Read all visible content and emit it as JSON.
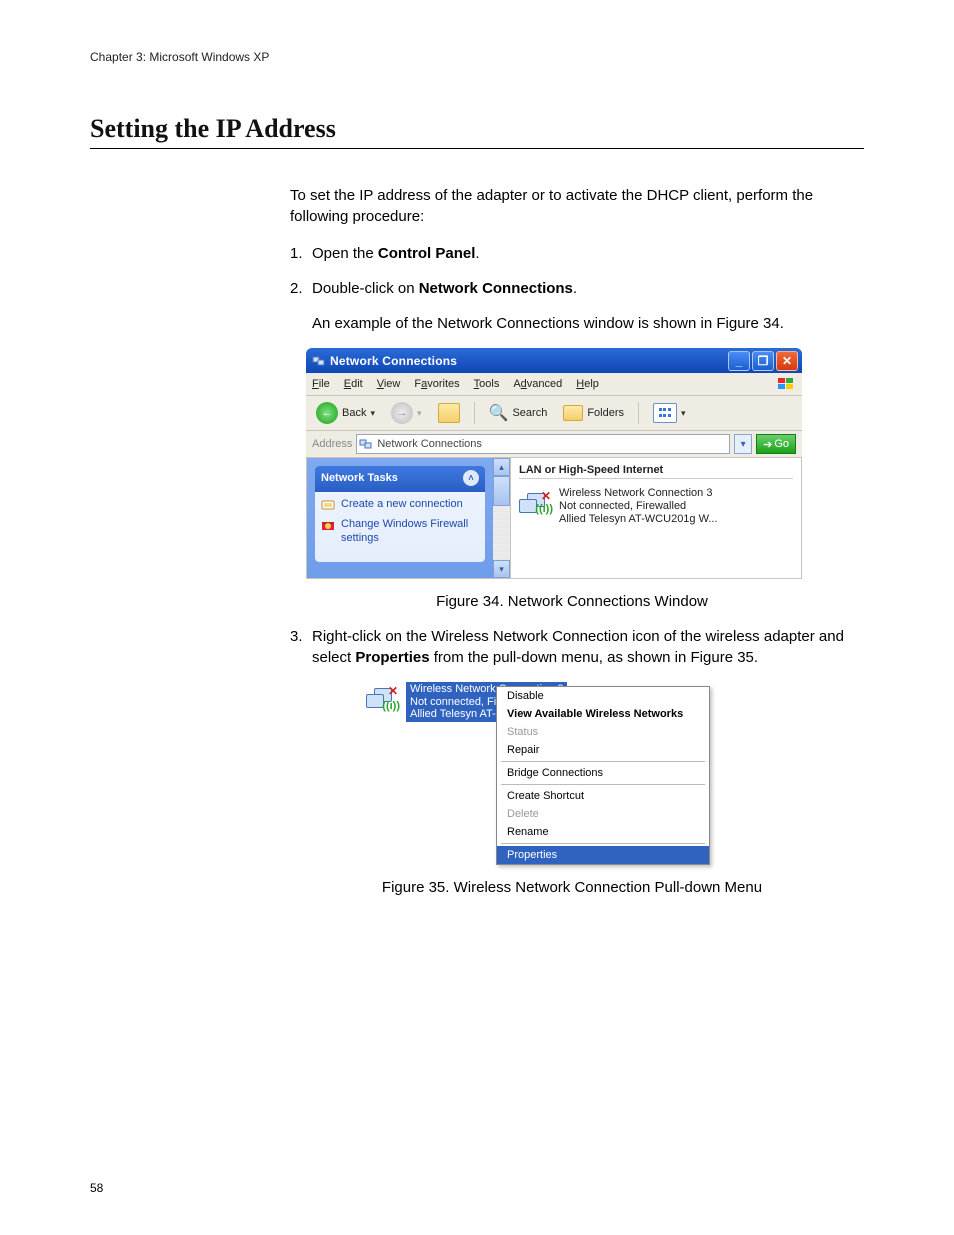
{
  "header": "Chapter 3: Microsoft Windows XP",
  "title": "Setting the IP Address",
  "intro": "To set the IP address of the adapter or to activate the DHCP client, perform the following procedure:",
  "step1_num": "1.",
  "step1_a": "Open the ",
  "step1_b_bold": "Control Panel",
  "step1_c": ".",
  "step2_num": "2.",
  "step2_a": "Double-click on ",
  "step2_b_bold": "Network Connections",
  "step2_c": ".",
  "step2_sub": "An example of the Network Connections window is shown in Figure 34.",
  "caption34": "Figure 34. Network Connections Window",
  "step3_num": "3.",
  "step3_a": "Right-click on the Wireless Network Connection icon of the wireless adapter and select ",
  "step3_b_bold": "Properties",
  "step3_c": " from the pull-down menu, as shown in Figure 35.",
  "caption35": "Figure 35. Wireless Network Connection Pull-down Menu",
  "page_number": "58",
  "fig34": {
    "window_title": "Network Connections",
    "menu": {
      "file": "File",
      "f": "F",
      "edit": "Edit",
      "e": "E",
      "view": "View",
      "v": "V",
      "favorites": "Favorites",
      "a": "a",
      "tools": "Tools",
      "t": "T",
      "advanced": "Advanced",
      "d": "d",
      "help": "Help",
      "h": "H"
    },
    "toolbar": {
      "back": "Back",
      "search": "Search",
      "folders": "Folders"
    },
    "address_label": "Address",
    "address_value": "Network Connections",
    "go": "Go",
    "tasks_header": "Network Tasks",
    "task1": "Create a new connection",
    "task2": "Change Windows Firewall settings",
    "group": "LAN or High-Speed Internet",
    "conn_name": "Wireless Network Connection 3",
    "conn_status": "Not connected, Firewalled",
    "conn_device": "Allied Telesyn AT-WCU201g W..."
  },
  "fig35": {
    "sel_name": "Wireless Network Connection 3",
    "sel_status": "Not connected, Firew",
    "sel_device": "Allied Telesyn AT-WC",
    "menu": {
      "disable": "Disable",
      "view": "View Available Wireless Networks",
      "status": "Status",
      "repair": "Repair",
      "bridge": "Bridge Connections",
      "shortcut": "Create Shortcut",
      "delete": "Delete",
      "rename": "Rename",
      "properties": "Properties"
    }
  }
}
